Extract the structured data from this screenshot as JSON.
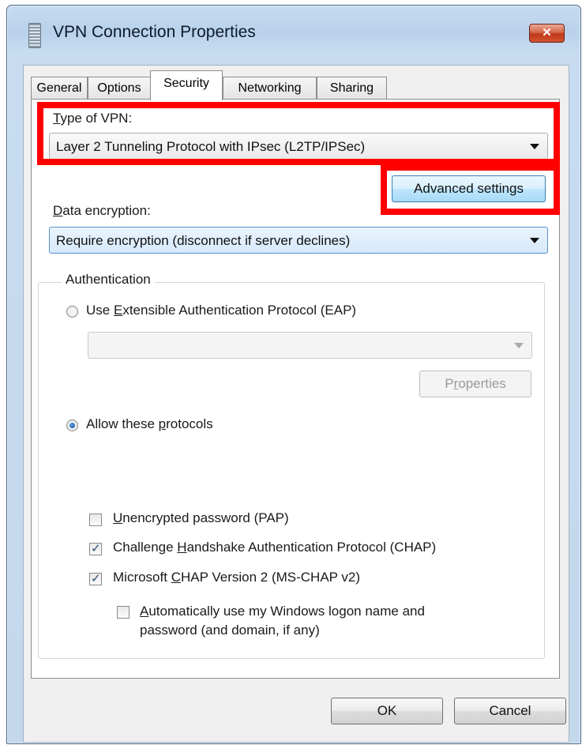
{
  "window": {
    "title": "VPN Connection Properties",
    "close_label": "✕"
  },
  "tabs": [
    {
      "label": "General"
    },
    {
      "label": "Options"
    },
    {
      "label": "Security",
      "active": true
    },
    {
      "label": "Networking"
    },
    {
      "label": "Sharing"
    }
  ],
  "security": {
    "vpn_type": {
      "label_mnemonic": "T",
      "label_rest": "ype of VPN:",
      "value": "Layer 2 Tunneling Protocol with IPsec (L2TP/IPSec)"
    },
    "advanced_settings_label": "Advanced settings",
    "data_encryption": {
      "label_mnemonic": "D",
      "label_rest": "ata encryption:",
      "value": "Require encryption (disconnect if server declines)"
    },
    "authentication": {
      "legend": "Authentication",
      "eap_option": {
        "pre": "Use ",
        "mnemonic": "E",
        "post": "xtensible Authentication Protocol (EAP)",
        "selected": false
      },
      "eap_dropdown_value": "",
      "properties_label": {
        "pre": "P",
        "mnemonic": "r",
        "post": "operties"
      },
      "protocols_option": {
        "pre": "Allow these ",
        "mnemonic": "p",
        "post": "rotocols",
        "selected": true
      },
      "protocols": [
        {
          "pre": "",
          "mnemonic": "U",
          "post": "nencrypted password (PAP)",
          "checked": false
        },
        {
          "pre": "Challenge ",
          "mnemonic": "H",
          "post": "andshake Authentication Protocol (CHAP)",
          "checked": true
        },
        {
          "pre": "Microsoft ",
          "mnemonic": "C",
          "post": "HAP Version 2 (MS-CHAP v2)",
          "checked": true
        }
      ],
      "auto_logon": {
        "mnemonic": "A",
        "line1_rest": "utomatically use my Windows logon name and",
        "line2": "password (and domain, if any)",
        "checked": false
      }
    }
  },
  "footer": {
    "ok_label": "OK",
    "cancel_label": "Cancel"
  },
  "colors": {
    "highlight": "#ff0000",
    "accent": "#3c7fb1"
  }
}
